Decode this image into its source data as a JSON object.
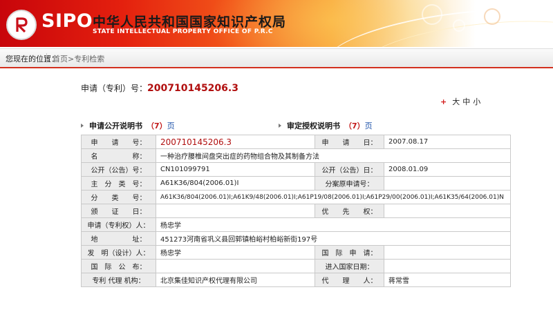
{
  "header": {
    "logo_text": "SIPO",
    "org_cn": "中华人民共和国国家知识产权局",
    "org_en": "STATE INTELLECTUAL PROPERTY OFFICE OF P.R.C"
  },
  "breadcrumb": {
    "label": "您现在的位置：",
    "path": "首页>专利检索"
  },
  "application": {
    "label": "申请（专利）号：",
    "number": "200710145206.3"
  },
  "font_sizer": {
    "plus": "+",
    "large": "大",
    "medium": "中",
    "small": "小"
  },
  "sections": {
    "publication": {
      "title": "申请公开说明书",
      "pages_open": "（7）",
      "pages_link": "页"
    },
    "grant": {
      "title": "审定授权说明书",
      "pages_open": "（7）",
      "pages_link": "页"
    }
  },
  "table": {
    "rows": [
      {
        "l1": "申　　请　　号：",
        "v1": "200710145206.3",
        "l2": "申　　请　　日：",
        "v2": "2007.08.17"
      },
      {
        "l1": "名　　　　　称：",
        "v1": "一种治疗腰椎间盘突出症的药物组合物及其制备方法"
      },
      {
        "l1": "公开（公告）号：",
        "v1": "CN101099791",
        "l2": "公开（公告）日：",
        "v2": "2008.01.09"
      },
      {
        "l1": "主　分　类　号：",
        "v1": "A61K36/804(2006.01)I",
        "l2": "分案原申请号：",
        "v2": ""
      },
      {
        "l1": "分　　类　　号：",
        "v1": "A61K36/804(2006.01)I;A61K9/48(2006.01)I;A61P19/08(2006.01)I;A61P29/00(2006.01)I;A61K35/64(2006.01)N"
      },
      {
        "l1": "颁　　证　　日：",
        "v1": "",
        "l2": "优　　先　　权：",
        "v2": ""
      },
      {
        "l1": "申请（专利权）人：",
        "v1": "杨忠学"
      },
      {
        "l1": "地　　　　　址：",
        "v1": "451273河南省巩义县回郭镇柏峪村柏峪新街197号"
      },
      {
        "l1": "发　明（设计）人：",
        "v1": "杨忠学",
        "l2": "国　际　申　请：",
        "v2": ""
      },
      {
        "l1": "国　际　公　布：",
        "v1": "",
        "l2": "进入国家日期：",
        "v2": ""
      },
      {
        "l1": "专利 代理 机构：",
        "v1": "北京集佳知识产权代理有限公司",
        "l2": "代　　理　　人：",
        "v2": "蒋常雪"
      }
    ]
  },
  "colors": {
    "brand_red": "#d32f1e",
    "number_red": "#b10f0f",
    "link_blue": "#1a4fa8"
  }
}
